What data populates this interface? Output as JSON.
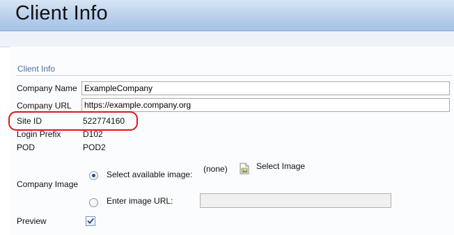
{
  "page": {
    "title": "Client Info"
  },
  "section": {
    "title": "Client Info"
  },
  "fields": {
    "company_name": {
      "label": "Company Name",
      "value": "ExampleCompany"
    },
    "company_url": {
      "label": "Company URL",
      "value": "https://example.company.org"
    },
    "site_id": {
      "label": "Site ID",
      "value": "522774160"
    },
    "login_prefix": {
      "label": "Login Prefix",
      "value": "D102"
    },
    "pod": {
      "label": "POD",
      "value": "POD2"
    }
  },
  "company_image": {
    "label": "Company Image",
    "option_available": {
      "label": "Select available image:",
      "selected": true
    },
    "current_image": "(none)",
    "select_image_link": "Select Image",
    "option_url": {
      "label": "Enter image URL:",
      "selected": false,
      "value": ""
    }
  },
  "preview": {
    "label": "Preview",
    "checked": true
  },
  "colors": {
    "highlight": "#e0141e",
    "header": "#b8cfec",
    "section_title": "#4d6f99"
  },
  "icons": {
    "select_image": "image-file-icon"
  }
}
